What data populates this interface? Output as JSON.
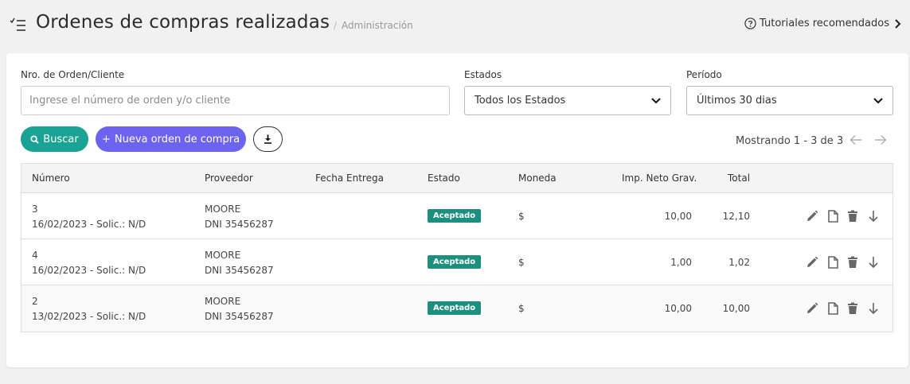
{
  "header": {
    "title": "Ordenes de compras realizadas",
    "breadcrumb_sep": "/",
    "breadcrumb": "Administración",
    "tutorials_label": "Tutoriales recomendados",
    "icons": [
      "menu-check-icon",
      "question-circle-icon",
      "chevron-right-icon"
    ]
  },
  "filters": {
    "order_label": "Nro. de Orden/Cliente",
    "order_placeholder": "Ingrese el número de orden y/o cliente",
    "order_value": "",
    "states_label": "Estados",
    "states_selected": "Todos los Estados",
    "period_label": "Período",
    "period_selected": "Últimos 30 dias"
  },
  "actions": {
    "search_label": "Buscar",
    "new_order_label": "Nueva orden de compra",
    "new_order_prefix": "+"
  },
  "pagination": {
    "showing": "Mostrando 1 - 3 de 3"
  },
  "table": {
    "columns": [
      "Número",
      "Proveedor",
      "Fecha Entrega",
      "Estado",
      "Moneda",
      "Imp. Neto Grav.",
      "Total"
    ],
    "rows": [
      {
        "number": "3",
        "date_info": "16/02/2023 - Solic.: N/D",
        "provider": "MOORE",
        "provider_doc": "DNI 35456287",
        "delivery": "",
        "status": "Aceptado",
        "currency": "$",
        "net": "10,00",
        "total": "12,10"
      },
      {
        "number": "4",
        "date_info": "16/02/2023 - Solic.: N/D",
        "provider": "MOORE",
        "provider_doc": "DNI 35456287",
        "delivery": "",
        "status": "Aceptado",
        "currency": "$",
        "net": "1,00",
        "total": "1,02"
      },
      {
        "number": "2",
        "date_info": "13/02/2023 - Solic.: N/D",
        "provider": "MOORE",
        "provider_doc": "DNI 35456287",
        "delivery": "",
        "status": "Aceptado",
        "currency": "$",
        "net": "10,00",
        "total": "10,00"
      }
    ]
  },
  "colors": {
    "primary_teal": "#1aa394",
    "primary_purple": "#6c63f0",
    "badge_green": "#1d8f7f"
  }
}
